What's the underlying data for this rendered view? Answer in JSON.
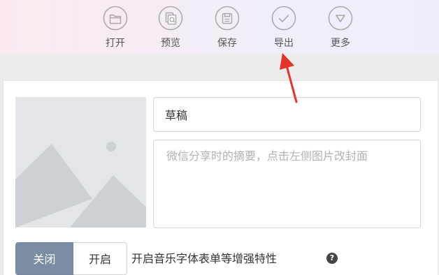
{
  "toolbar": {
    "open_label": "打开",
    "preview_label": "预览",
    "save_label": "保存",
    "export_label": "导出",
    "more_label": "更多"
  },
  "editor": {
    "title_value": "草稿",
    "summary_placeholder": "微信分享时的摘要，点击左侧图片改封面",
    "cover_icon": "image-placeholder-icon"
  },
  "enhance": {
    "off_label": "关闭",
    "on_label": "开启",
    "description": "开启音乐字体表单等增强特性",
    "help_icon": "question-circle-icon",
    "selected": "off"
  },
  "colors": {
    "toggle_selected": "#7c8da3",
    "toolbar_icon": "#a9a9a9",
    "annotation_arrow": "#e6332a"
  }
}
